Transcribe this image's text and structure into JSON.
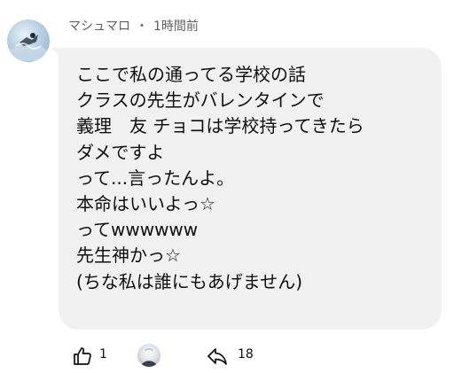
{
  "comment": {
    "author": "マシュマロ",
    "separator": "・",
    "time": "1時間前",
    "lines": [
      "ここで私の通ってる学校の話",
      "クラスの先生がバレンタインで",
      "義理　友 チョコは学校持ってきたら",
      "ダメですよ",
      "って...言ったんよ。",
      "本命はいいよっ☆",
      "ってwwwwww",
      "先生神かっ☆",
      "(ちな私は誰にもあげません)"
    ]
  },
  "actions": {
    "like_count": "1",
    "reply_count": "18",
    "icons": [
      "thumbs-up-icon",
      "creator-heart-avatar",
      "reply-arrow-icon"
    ]
  },
  "colors": {
    "bubble": "#f1f1f1",
    "meta_text": "#606060",
    "body_text": "#0f0f0f"
  }
}
